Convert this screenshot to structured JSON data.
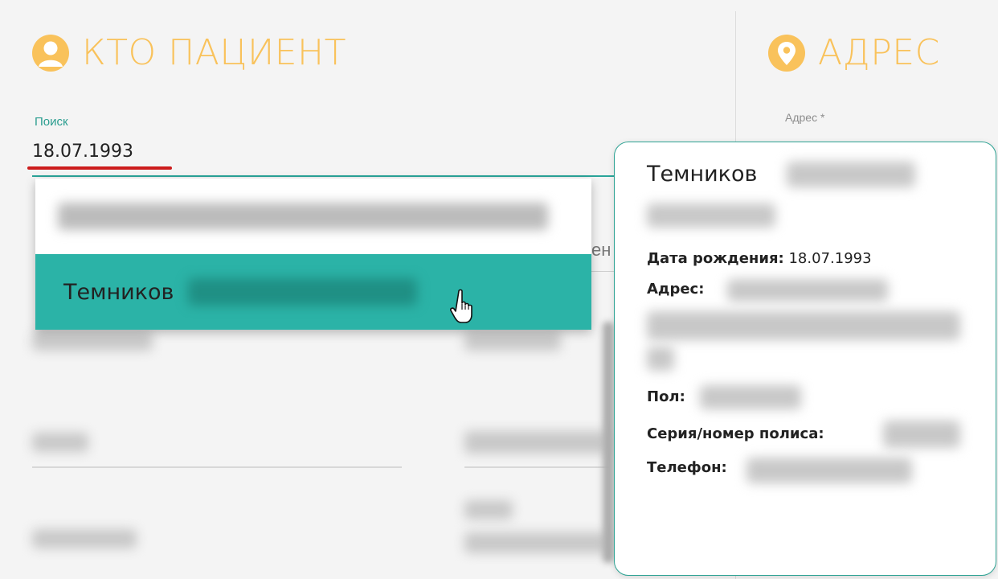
{
  "patient_section": {
    "title": "КТО ПАЦИЕНТ",
    "icon": "user-icon"
  },
  "address_section": {
    "title": "АДРЕС",
    "icon": "location-pin-icon",
    "field_label": "Адрес *"
  },
  "search": {
    "label": "Поиск",
    "value": "18.07.1993"
  },
  "dropdown": {
    "items": [
      {
        "name": ""
      },
      {
        "name": "Темников"
      }
    ]
  },
  "background_fragment": "ен",
  "popup": {
    "name": "Темников",
    "birth_date_label": "Дата рождения:",
    "birth_date_value": "18.07.1993",
    "address_label": "Адрес:",
    "gender_label": "Пол:",
    "policy_label": "Серия/номер полиса:",
    "phone_label": "Телефон:"
  },
  "colors": {
    "accent_orange": "#f9c25b",
    "teal": "#2bb3a7",
    "teal_dark": "#2a9d8f",
    "highlight_red": "#cc1c1c"
  }
}
